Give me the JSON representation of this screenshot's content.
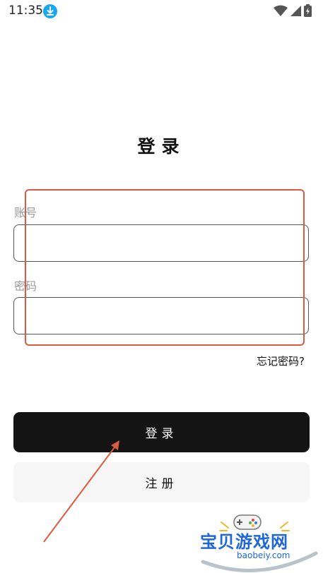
{
  "status_bar": {
    "time": "11:35"
  },
  "page": {
    "title": "登录"
  },
  "form": {
    "account_label": "账号",
    "account_value": "",
    "password_label": "密码",
    "password_value": "",
    "forgot_link": "忘记密码?"
  },
  "buttons": {
    "login": "登录",
    "register": "注册"
  },
  "watermark": {
    "brand": "宝贝游戏网",
    "url": "baobeiy.com"
  },
  "colors": {
    "primary_button": "#141414",
    "secondary_button": "#f6f6f6",
    "highlight": "#d95b44",
    "download_badge": "#1aa6f0",
    "watermark": "#1f66d8"
  }
}
